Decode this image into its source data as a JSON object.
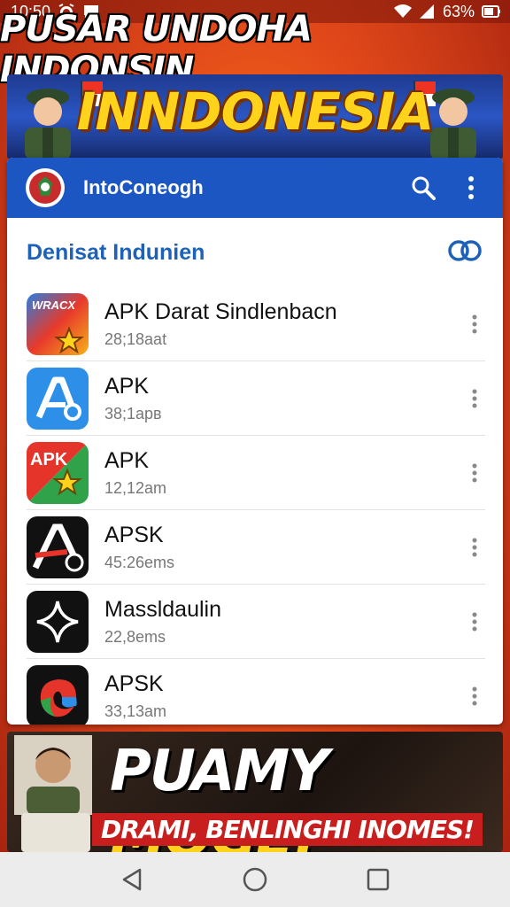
{
  "status_bar": {
    "time": "10:50",
    "battery": "63%",
    "icons": [
      "alarm-icon",
      "chat-icon",
      "wifi-icon",
      "signal-icon",
      "battery-icon"
    ]
  },
  "headline": "PUSAR UNDOHA INDONSIN",
  "banner": {
    "title": "INNDONESIA"
  },
  "app": {
    "title": "IntoConeogh",
    "actions": [
      "search-icon",
      "more-vert-icon"
    ],
    "section_title": "Denisat Indunien",
    "section_icon": "link-icon",
    "items": [
      {
        "name": "APK Darat  Sindlenbacn",
        "sub": "28;18aat",
        "icon_text": "WRACX"
      },
      {
        "name": "APK",
        "sub": "38;1apв",
        "icon_text": ""
      },
      {
        "name": "APK",
        "sub": "12,12am",
        "icon_text": "APK"
      },
      {
        "name": "APSK",
        "sub": "45:26ems",
        "icon_text": ""
      },
      {
        "name": "Massldaulin",
        "sub": "22,8ems",
        "icon_text": ""
      },
      {
        "name": "APSK",
        "sub": "33,13am",
        "icon_text": ""
      }
    ]
  },
  "promo": {
    "big_white": "PUAMY ",
    "big_yellow": "MOGE!’",
    "small": "DRAMI, BENLINGHI INOMES!"
  },
  "nav": [
    "back-icon",
    "home-icon",
    "recents-icon"
  ],
  "colors": {
    "accent": "#1b56c2",
    "section_title": "#1e62b8",
    "banner_title": "#ffd21c",
    "promo_red": "#c81e1e"
  }
}
